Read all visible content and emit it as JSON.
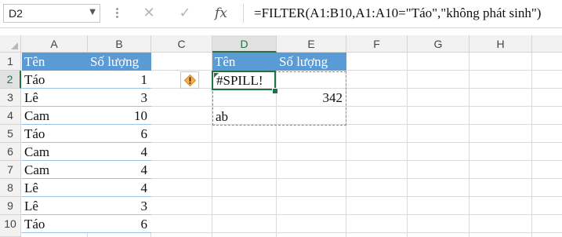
{
  "formula_bar": {
    "name_box": "D2",
    "cancel_icon": "✕",
    "enter_icon": "✓",
    "fx_label": "fx",
    "formula": "=FILTER(A1:B10,A1:A10=\"Táo\",\"không phát sinh\")"
  },
  "columns": [
    "A",
    "B",
    "C",
    "D",
    "E",
    "F",
    "G",
    "H"
  ],
  "rows": [
    "1",
    "2",
    "3",
    "4",
    "5",
    "6",
    "7",
    "8",
    "9",
    "10"
  ],
  "table": {
    "headers": [
      "Tên",
      "Số lượng"
    ],
    "rows": [
      [
        "Táo",
        "1"
      ],
      [
        "Lê",
        "3"
      ],
      [
        "Cam",
        "10"
      ],
      [
        "Táo",
        "6"
      ],
      [
        "Cam",
        "4"
      ],
      [
        "Cam",
        "4"
      ],
      [
        "Lê",
        "4"
      ],
      [
        "Lê",
        "3"
      ],
      [
        "Táo",
        "6"
      ]
    ]
  },
  "result": {
    "headers": [
      "Tên",
      "Số lượng"
    ],
    "d2": "#SPILL!",
    "e3": "342",
    "d4": "ab"
  },
  "colors": {
    "header_fill": "#5b9bd5",
    "selection": "#217346",
    "spill_border": "#6b8cc5",
    "warning": "#f5b14a"
  },
  "icons": {
    "warning": "warning-diamond-icon"
  }
}
